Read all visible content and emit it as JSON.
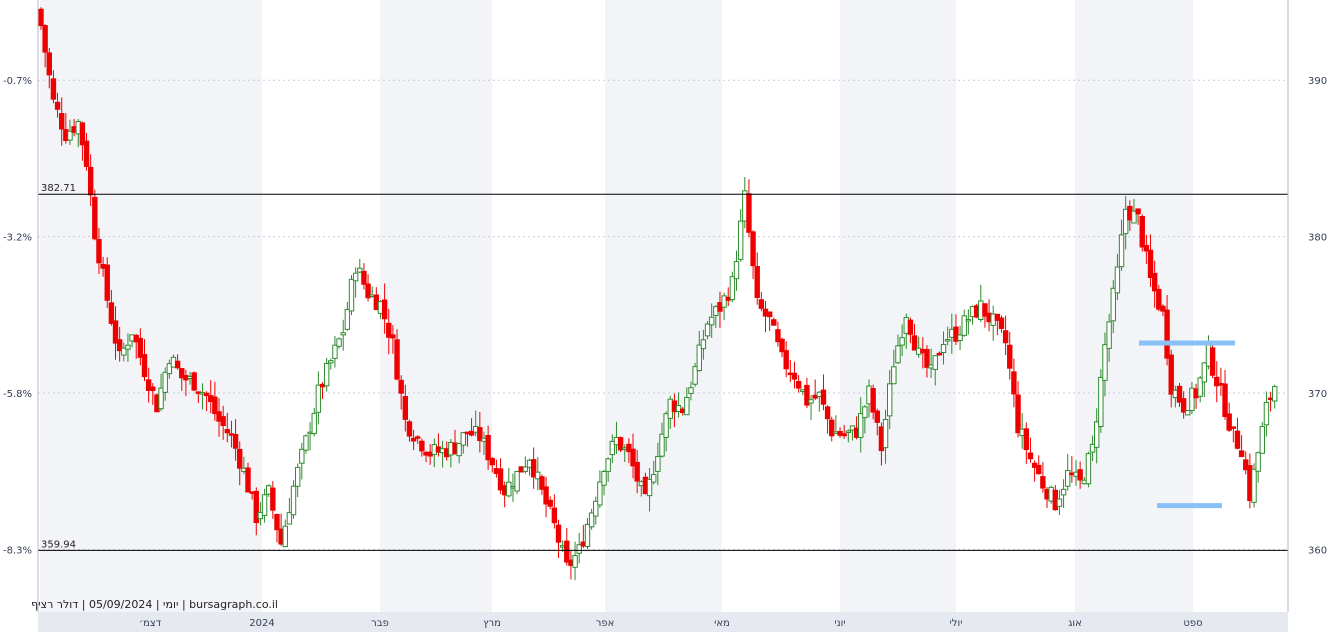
{
  "chart_data": {
    "type": "candlestick",
    "credit": "יומי | 05/09/2024 | דולר רציף | bursagraph.co.il",
    "x_labels": [
      "דצמ׳",
      "2024",
      "פבר",
      "מרץ",
      "אפר",
      "מאי",
      "יוני",
      "יולי",
      "אוג",
      "ספט"
    ],
    "y_right_ticks": [
      "390",
      "380",
      "370",
      "360"
    ],
    "y_left_ticks": [
      "-0.7%",
      "-3.2%",
      "-5.8%",
      "-8.3%"
    ],
    "ylim": [
      356,
      395
    ],
    "levels": [
      {
        "label": "382.71",
        "value": 382.71
      },
      {
        "label": "359.94",
        "value": 359.94
      }
    ],
    "highlight_levels": [
      373.2,
      362.8
    ],
    "up_color": "#2e8b2e",
    "down_color": "#ee0000",
    "highlight_color": "#88c1f5",
    "grid_color": "#c8ccd8",
    "stripe_color": "#f3f4f8",
    "waypoints": [
      [
        0,
        393.5
      ],
      [
        3,
        388.6
      ],
      [
        6,
        386.6
      ],
      [
        9,
        387.3
      ],
      [
        11,
        384.8
      ],
      [
        13,
        380.3
      ],
      [
        16,
        376.0
      ],
      [
        19,
        372.2
      ],
      [
        22,
        374.0
      ],
      [
        25,
        371.5
      ],
      [
        28,
        369.2
      ],
      [
        31,
        372.4
      ],
      [
        34,
        371.0
      ],
      [
        37,
        370.7
      ],
      [
        40,
        369.8
      ],
      [
        43,
        368.2
      ],
      [
        46,
        367.2
      ],
      [
        49,
        365.0
      ],
      [
        52,
        362.1
      ],
      [
        55,
        363.6
      ],
      [
        58,
        360.4
      ],
      [
        61,
        364.0
      ],
      [
        64,
        366.9
      ],
      [
        67,
        370.0
      ],
      [
        70,
        372.0
      ],
      [
        73,
        374.0
      ],
      [
        76,
        378.2
      ],
      [
        79,
        376.4
      ],
      [
        82,
        375.7
      ],
      [
        85,
        373.1
      ],
      [
        88,
        368.2
      ],
      [
        91,
        367.1
      ],
      [
        94,
        366.2
      ],
      [
        97,
        366.3
      ],
      [
        100,
        366.6
      ],
      [
        103,
        367.5
      ],
      [
        106,
        367.2
      ],
      [
        109,
        365.6
      ],
      [
        112,
        363.8
      ],
      [
        115,
        364.8
      ],
      [
        118,
        366.0
      ],
      [
        121,
        363.6
      ],
      [
        124,
        361.5
      ],
      [
        127,
        358.8
      ],
      [
        130,
        359.9
      ],
      [
        133,
        362.5
      ],
      [
        136,
        365.5
      ],
      [
        139,
        367.0
      ],
      [
        142,
        366.0
      ],
      [
        144,
        364.5
      ],
      [
        146,
        363.0
      ],
      [
        149,
        366.4
      ],
      [
        152,
        369.4
      ],
      [
        155,
        369.0
      ],
      [
        158,
        371.5
      ],
      [
        161,
        374.5
      ],
      [
        164,
        375.5
      ],
      [
        167,
        377.0
      ],
      [
        170,
        382.5
      ],
      [
        173,
        375.6
      ],
      [
        176,
        374.6
      ],
      [
        179,
        372.1
      ],
      [
        182,
        371.2
      ],
      [
        185,
        369.5
      ],
      [
        188,
        369.8
      ],
      [
        191,
        367.6
      ],
      [
        194,
        367.3
      ],
      [
        197,
        367.6
      ],
      [
        200,
        370.0
      ],
      [
        203,
        366.5
      ],
      [
        206,
        372.0
      ],
      [
        209,
        375.2
      ],
      [
        212,
        372.4
      ],
      [
        215,
        371.2
      ],
      [
        218,
        373.5
      ],
      [
        221,
        373.8
      ],
      [
        224,
        374.8
      ],
      [
        227,
        375.5
      ],
      [
        230,
        374.5
      ],
      [
        233,
        373.2
      ],
      [
        236,
        367.9
      ],
      [
        239,
        365.8
      ],
      [
        242,
        364.2
      ],
      [
        245,
        363.0
      ],
      [
        248,
        364.8
      ],
      [
        251,
        364.2
      ],
      [
        254,
        366.4
      ],
      [
        257,
        373.0
      ],
      [
        260,
        377.7
      ],
      [
        262,
        381.8
      ],
      [
        265,
        381.1
      ],
      [
        268,
        377.2
      ],
      [
        271,
        375.0
      ],
      [
        273,
        370.5
      ],
      [
        276,
        369.2
      ],
      [
        279,
        370.0
      ],
      [
        282,
        372.5
      ],
      [
        285,
        370.0
      ],
      [
        288,
        367.2
      ],
      [
        290,
        366.5
      ],
      [
        292,
        363.5
      ],
      [
        294,
        366.2
      ],
      [
        296,
        369.0
      ],
      [
        298,
        370.5
      ]
    ]
  }
}
